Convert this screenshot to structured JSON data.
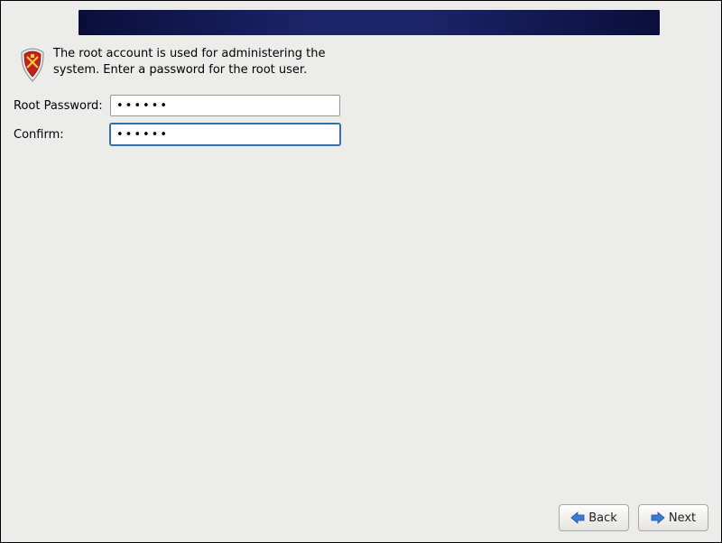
{
  "icon": "shield-icon",
  "description": "The root account is used for administering the system.  Enter a password for the root user.",
  "form": {
    "root_password_label": "Root Password:",
    "root_password_value": "••••••",
    "confirm_label": "Confirm:",
    "confirm_value": "••••••"
  },
  "buttons": {
    "back_label": "Back",
    "next_label": "Next"
  }
}
